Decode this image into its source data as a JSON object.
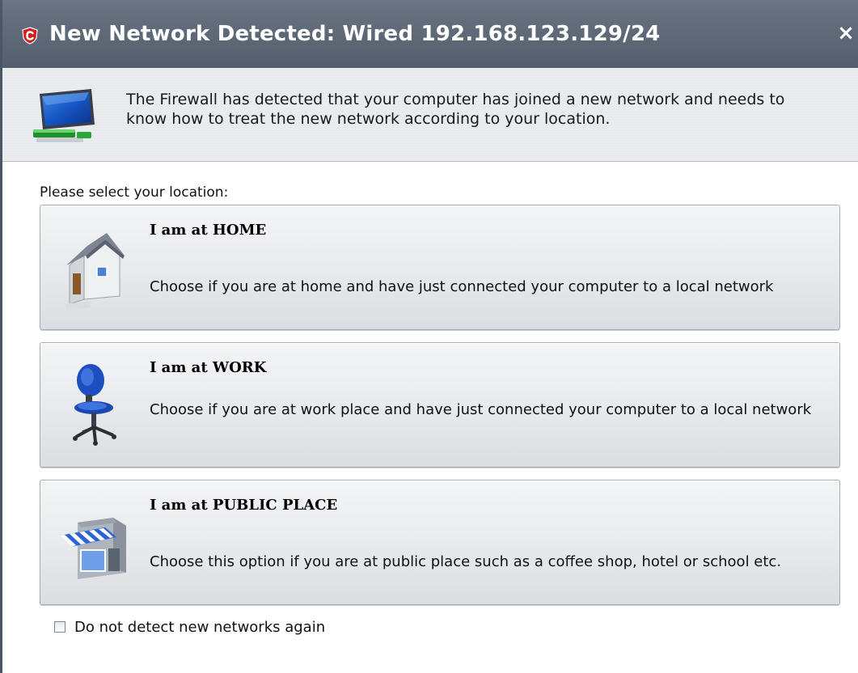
{
  "window": {
    "title": "New Network Detected: Wired 192.168.123.129/24",
    "close_glyph": "×",
    "accent_color": "#d11f1f",
    "titlebar_color": "#5d6775"
  },
  "banner": {
    "icon": "network-monitor-icon",
    "message": "The Firewall has detected that your computer has joined a new network and needs to know how to treat the new network according to your location."
  },
  "prompt": "Please select your location:",
  "options": [
    {
      "icon": "house-icon",
      "title": "I am at HOME",
      "description": "Choose if you are at home and have just connected your computer to a local network"
    },
    {
      "icon": "office-chair-icon",
      "title": "I am at WORK",
      "description": "Choose if you are at work place and have just connected your computer to a local network"
    },
    {
      "icon": "storefront-icon",
      "title": "I am at PUBLIC PLACE",
      "description": "Choose this option if you are at public place such as a coffee shop, hotel or school etc."
    }
  ],
  "checkbox": {
    "label": "Do not detect new networks again",
    "checked": false
  }
}
